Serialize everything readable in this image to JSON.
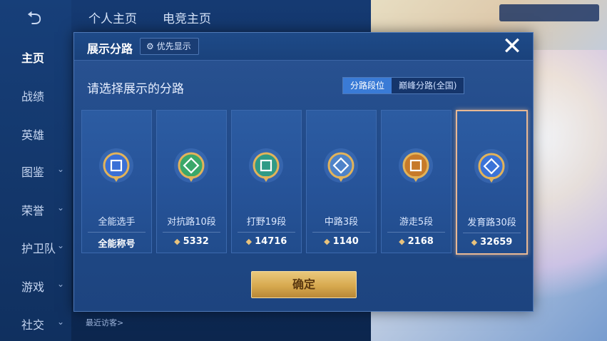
{
  "background": {
    "nav": [
      {
        "label": "主页",
        "active": true,
        "chevron": false
      },
      {
        "label": "战绩",
        "chevron": false
      },
      {
        "label": "英雄",
        "chevron": false
      },
      {
        "label": "图鉴",
        "chevron": true
      },
      {
        "label": "荣誉",
        "chevron": true
      },
      {
        "label": "护卫队",
        "chevron": true
      },
      {
        "label": "游戏",
        "chevron": true
      },
      {
        "label": "社交",
        "chevron": true
      }
    ],
    "top_tabs": [
      "个人主页",
      "电竞主页"
    ],
    "visitors_label": "最近访客>"
  },
  "dialog": {
    "title": "展示分路",
    "priority_button": "优先显示",
    "prompt": "请选择展示的分路",
    "segment": {
      "options": [
        "分路段位",
        "巅峰分路(全国)"
      ],
      "active_index": 0
    },
    "cards": [
      {
        "label": "全能选手",
        "score": "全能称号",
        "badge_color": "#3a6fd6",
        "diamond": false,
        "selected": false
      },
      {
        "label": "对抗路10段",
        "score": "5332",
        "badge_color": "#3aa86a",
        "diamond": true,
        "selected": false
      },
      {
        "label": "打野19段",
        "score": "14716",
        "badge_color": "#2f9a86",
        "diamond": true,
        "selected": false
      },
      {
        "label": "中路3段",
        "score": "1140",
        "badge_color": "#4e83c9",
        "diamond": true,
        "selected": false
      },
      {
        "label": "游走5段",
        "score": "2168",
        "badge_color": "#c77a2a",
        "diamond": true,
        "selected": false
      },
      {
        "label": "发育路30段",
        "score": "32659",
        "badge_color": "#3b73d8",
        "diamond": true,
        "selected": true
      }
    ],
    "confirm_label": "确定"
  },
  "colors": {
    "accent_blue": "#3a7bd6",
    "selected_border": "#e8b894",
    "confirm_gold": "#d7a94f"
  }
}
